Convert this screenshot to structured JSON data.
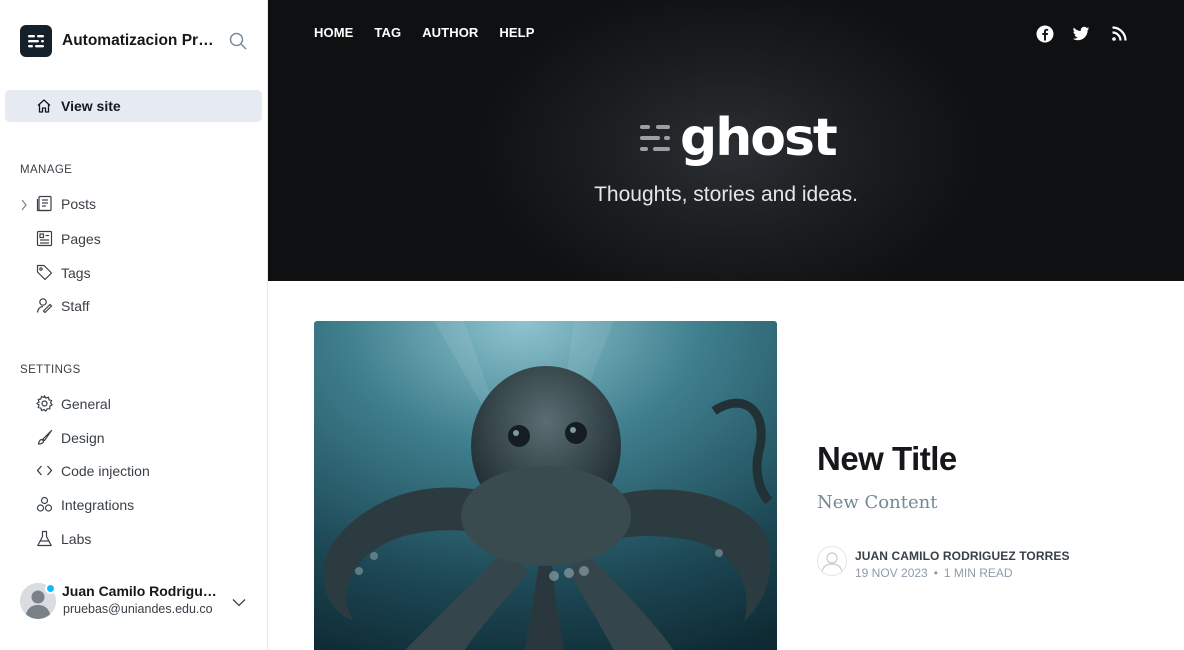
{
  "sidebar": {
    "site_title": "Automatizacion Pruebas",
    "view_site": "View site",
    "manage_heading": "MANAGE",
    "manage_items": [
      {
        "label": "Posts",
        "icon": "posts-icon"
      },
      {
        "label": "Pages",
        "icon": "pages-icon"
      },
      {
        "label": "Tags",
        "icon": "tag-icon"
      },
      {
        "label": "Staff",
        "icon": "staff-icon"
      }
    ],
    "settings_heading": "SETTINGS",
    "settings_items": [
      {
        "label": "General",
        "icon": "gear-icon"
      },
      {
        "label": "Design",
        "icon": "brush-icon"
      },
      {
        "label": "Code injection",
        "icon": "code-icon"
      },
      {
        "label": "Integrations",
        "icon": "integrations-icon"
      },
      {
        "label": "Labs",
        "icon": "flask-icon"
      }
    ],
    "user": {
      "name": "Juan Camilo Rodriguez Torres",
      "email": "pruebas@uniandes.edu.co"
    }
  },
  "site": {
    "nav": [
      "HOME",
      "TAG",
      "AUTHOR",
      "HELP"
    ],
    "social_icons": [
      "facebook-icon",
      "twitter-icon",
      "rss-icon"
    ],
    "logo_text": "ghost",
    "tagline": "Thoughts, stories and ideas.",
    "post": {
      "title": "New Title",
      "excerpt": "New Content",
      "author": "JUAN CAMILO RODRIGUEZ TORRES",
      "date": "19 NOV 2023",
      "reading_time": "1 MIN READ",
      "separator": "•"
    }
  },
  "colors": {
    "sidebar_active_bg": "#e6ebf3",
    "hero_bg": "#1a1c1e",
    "excerpt": "#738a94",
    "status_dot": "#14b8ff"
  }
}
